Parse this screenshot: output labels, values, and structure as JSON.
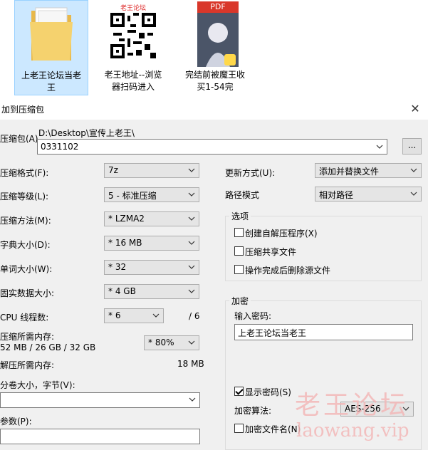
{
  "files": [
    {
      "label_line1": "上老王论坛当老",
      "label_line2": "王",
      "kind": "folder"
    },
    {
      "label_line1": "老王地址--浏览",
      "label_line2": "器扫码进入",
      "kind": "qr",
      "thumb_text": "老王论坛"
    },
    {
      "label_line1": "完结前被魔王收",
      "label_line2": "买1-54完",
      "kind": "pdf",
      "thumb_text": "PDF"
    }
  ],
  "dialog": {
    "title": "加到压缩包",
    "archive_label": "压缩包(A)",
    "archive_path": "D:\\Desktop\\宣传上老王\\",
    "archive_name": "0331102",
    "browse_label": "...",
    "format_label": "压缩格式(F):",
    "format_value": "7z",
    "level_label": "压缩等级(L):",
    "level_value": "5 - 标准压缩",
    "method_label": "压缩方法(M):",
    "method_value": "* LZMA2",
    "dict_label": "字典大小(D):",
    "dict_value": "* 16 MB",
    "word_label": "单词大小(W):",
    "word_value": "* 32",
    "solid_label": "固实数据大小:",
    "solid_value": "* 4 GB",
    "cpu_label": "CPU 线程数:",
    "cpu_value": "* 6",
    "cpu_total": "/ 6",
    "mem_label": "压缩所需内存:",
    "mem_value": "52 MB / 26 GB / 32 GB",
    "mem_percent": "* 80%",
    "decomp_label": "解压所需内存:",
    "decomp_value": "18 MB",
    "volume_label": "分卷大小，字节(V):",
    "params_label": "参数(P):",
    "update_label": "更新方式(U):",
    "update_value": "添加并替换文件",
    "path_label": "路径模式",
    "path_value": "相对路径",
    "options_title": "选项",
    "opt_sfx": "创建自解压程序(X)",
    "opt_shared": "压缩共享文件",
    "opt_delete": "操作完成后删除源文件",
    "encrypt_title": "加密",
    "password_label": "输入密码:",
    "password_value": "上老王论坛当老王",
    "show_password": "显示密码(S)",
    "enc_method_label": "加密算法:",
    "enc_method_value": "AES-256",
    "encrypt_names": "加密文件名(N)"
  },
  "watermark": {
    "cn": "老王论坛",
    "url": "laowang.vip"
  }
}
